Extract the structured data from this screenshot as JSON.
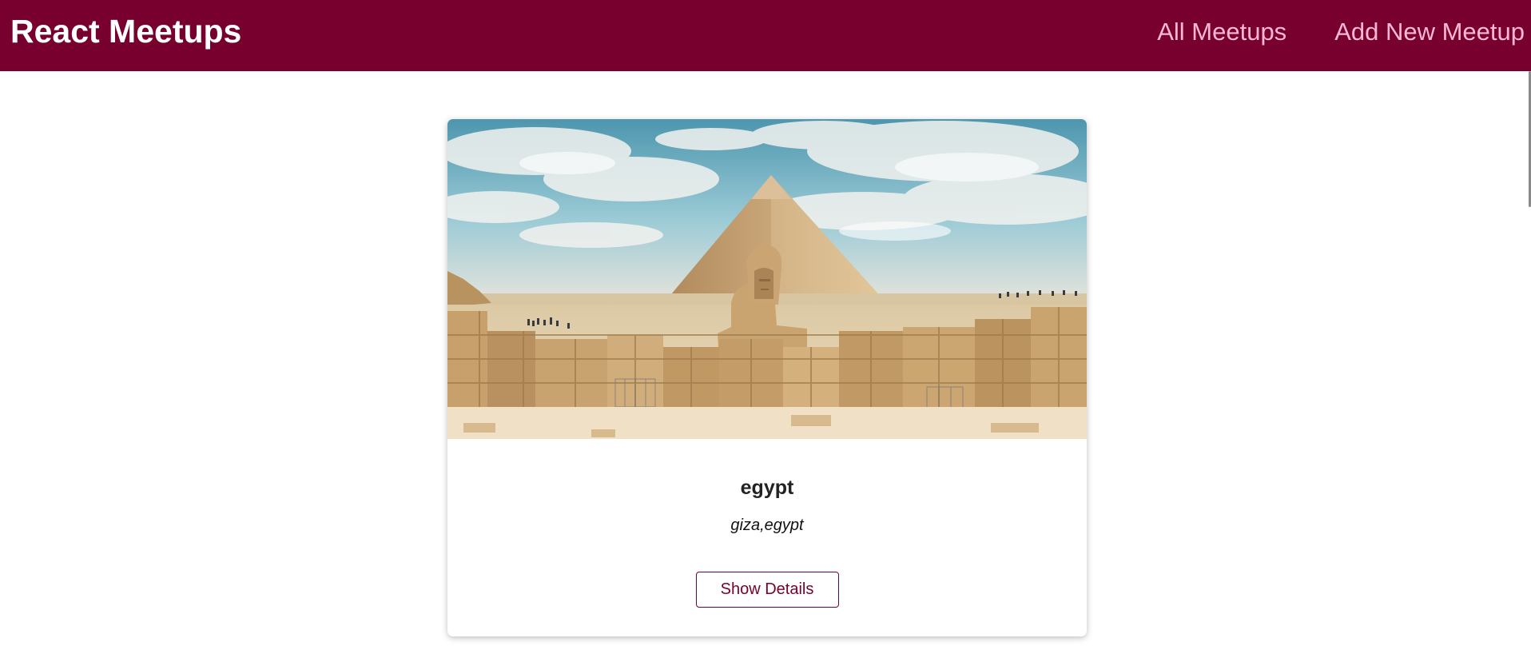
{
  "header": {
    "logo": "React Meetups",
    "nav": [
      {
        "label": "All Meetups"
      },
      {
        "label": "Add New Meetup"
      }
    ]
  },
  "meetups": [
    {
      "title": "egypt",
      "address": "giza,egypt",
      "button_label": "Show Details",
      "image_subject": "pyramid and sphinx at giza"
    }
  ],
  "colors": {
    "brand": "#77002e",
    "nav_link": "#fcb8d2",
    "background": "#ffffff"
  }
}
